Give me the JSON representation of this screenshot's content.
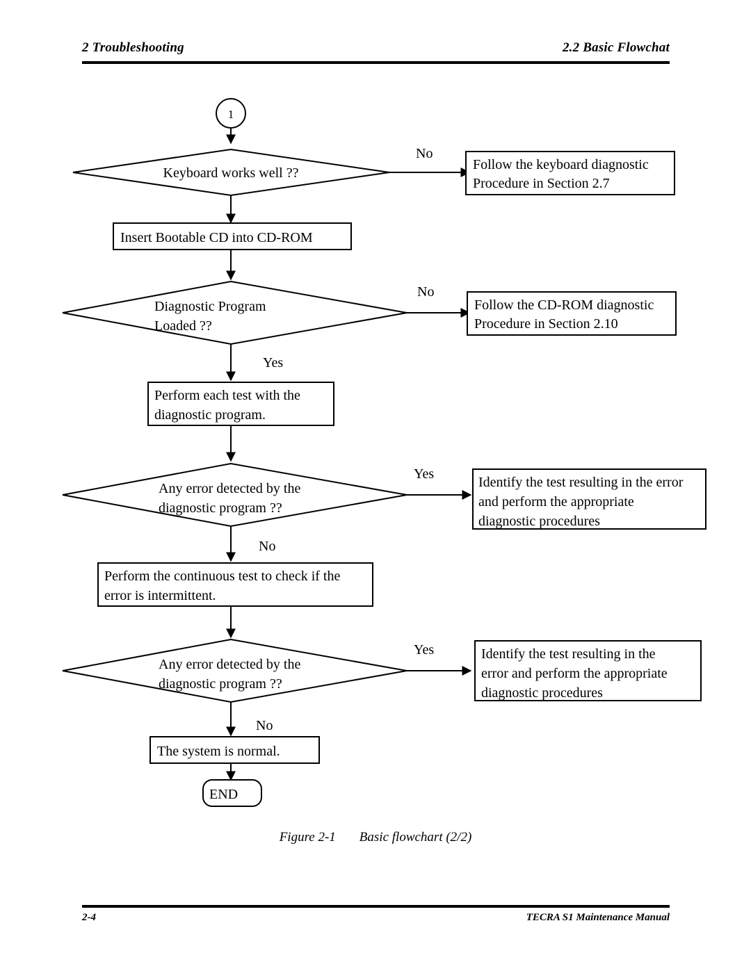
{
  "header": {
    "left": "2  Troubleshooting",
    "right": "2.2  Basic Flowchat"
  },
  "footer": {
    "left": "2-4",
    "right": "TECRA S1  Maintenance Manual"
  },
  "caption": {
    "number": "Figure 2-1",
    "title": "Basic flowchart (2/2)"
  },
  "flowchart": {
    "connector_in": "1",
    "nodes": {
      "d1": {
        "line1": "Keyboard works well ??"
      },
      "p1": {
        "line1": "Insert Bootable CD into CD-ROM"
      },
      "d2": {
        "line1": "Diagnostic Program",
        "line2": "Loaded  ??"
      },
      "p2": {
        "line1": "Follow the keyboard diagnostic",
        "line2": "Procedure in Section 2.7"
      },
      "p3": {
        "line1": "Follow the CD-ROM diagnostic",
        "line2": "Procedure in Section 2.10"
      },
      "p4": {
        "line1": "Perform each test with the",
        "line2": "diagnostic program."
      },
      "d3": {
        "line1": "Any error detected by the",
        "line2": "diagnostic program ??"
      },
      "p5": {
        "line1": "Identify the test resulting in the error",
        "line2": "and perform the appropriate",
        "line3": "diagnostic procedures"
      },
      "p6": {
        "line1": "Perform the continuous test to check if the",
        "line2": "error is intermittent."
      },
      "d4": {
        "line1": "Any error detected by the",
        "line2": "diagnostic program ??"
      },
      "p7": {
        "line1": "Identify the test resulting in the",
        "line2": "error and perform the appropriate",
        "line3": "diagnostic procedures"
      },
      "p8": {
        "line1": "The system is normal."
      },
      "end": {
        "line1": "END"
      }
    },
    "edge_labels": {
      "d1_no": "No",
      "d2_no": "No",
      "d2_yes": "Yes",
      "d3_yes": "Yes",
      "d3_no": "No",
      "d4_yes": "Yes",
      "d4_no": "No"
    },
    "colors": {
      "line": "#000000",
      "fill": "#ffffff",
      "text": "#000000"
    }
  }
}
